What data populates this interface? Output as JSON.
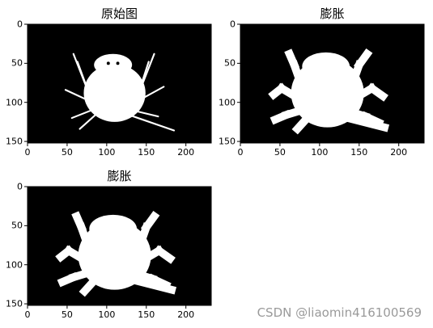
{
  "watermark": "CSDN @liaomin416100569",
  "chart_data": [
    {
      "type": "image",
      "title": "原始图",
      "xlim": [
        0,
        232
      ],
      "ylim": [
        152,
        0
      ],
      "xticks": [
        0,
        50,
        100,
        150,
        200
      ],
      "yticks": [
        0,
        50,
        100,
        150
      ],
      "image": "spider-original"
    },
    {
      "type": "image",
      "title": "膨胀",
      "xlim": [
        0,
        232
      ],
      "ylim": [
        152,
        0
      ],
      "xticks": [
        0,
        50,
        100,
        150,
        200
      ],
      "yticks": [
        0,
        50,
        100,
        150
      ],
      "image": "spider-dilated"
    },
    {
      "type": "image",
      "title": "膨胀",
      "xlim": [
        0,
        232
      ],
      "ylim": [
        152,
        0
      ],
      "xticks": [
        0,
        50,
        100,
        150,
        200
      ],
      "yticks": [
        0,
        50,
        100,
        150
      ],
      "image": "spider-dilated"
    }
  ]
}
